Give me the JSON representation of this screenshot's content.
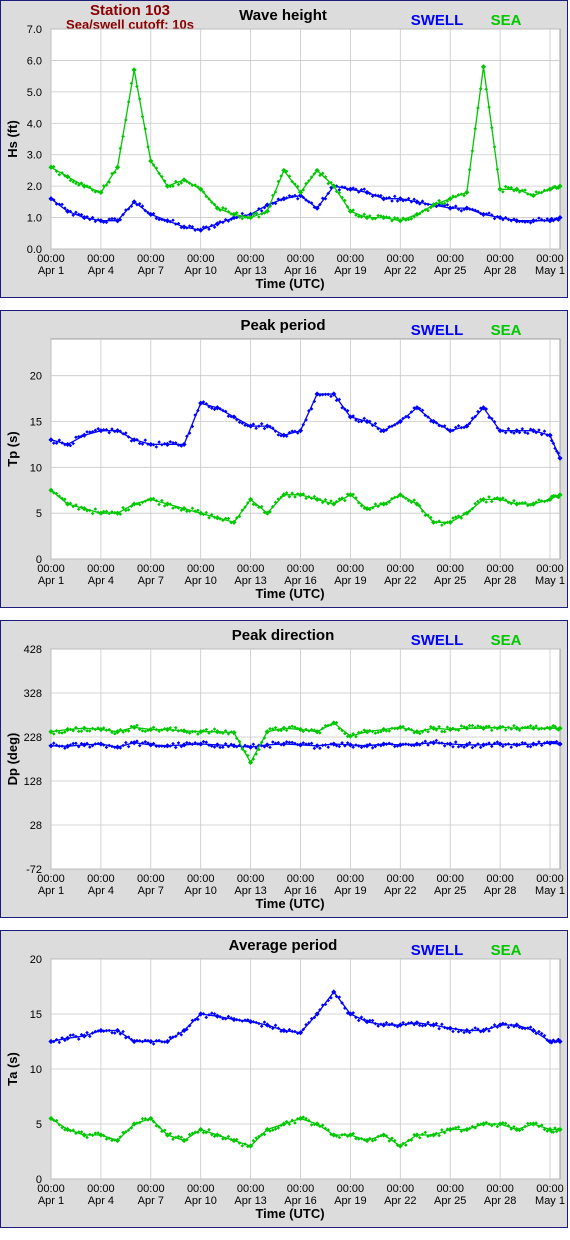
{
  "header": {
    "station": "Station 103",
    "cutoff": "Sea/swell cutoff: 10s"
  },
  "legend": {
    "swell": "SWELL",
    "sea": "SEA"
  },
  "colors": {
    "swell": "#0000ff",
    "sea": "#00c800",
    "title_red": "#8b0000",
    "border": "#1c1c7c"
  },
  "x_ticks": [
    "Apr 1",
    "Apr 4",
    "Apr 7",
    "Apr 10",
    "Apr 13",
    "Apr 16",
    "Apr 19",
    "Apr 22",
    "Apr 25",
    "Apr 28",
    "May 1"
  ],
  "x_tick_time": "00:00",
  "xlabel": "Time (UTC)",
  "chart_data": [
    {
      "type": "scatter",
      "title": "Wave height",
      "ylabel": "Hs (ft)",
      "ylim": [
        0,
        7
      ],
      "yticks": [
        "0.0",
        "1.0",
        "2.0",
        "3.0",
        "4.0",
        "5.0",
        "6.0",
        "7.0"
      ],
      "x": [
        0,
        1,
        2,
        3,
        4,
        5,
        6,
        7,
        8,
        9,
        10,
        11,
        12,
        13,
        14,
        15,
        16,
        17,
        18,
        19,
        20,
        21,
        22,
        23,
        24,
        25,
        26,
        27,
        28,
        29,
        30,
        30.6
      ],
      "series": [
        {
          "name": "SWELL",
          "values": [
            1.6,
            1.2,
            1.0,
            0.9,
            0.9,
            1.5,
            1.1,
            0.9,
            0.7,
            0.6,
            0.8,
            1.0,
            1.1,
            1.4,
            1.6,
            1.7,
            1.3,
            2.0,
            1.9,
            1.8,
            1.6,
            1.6,
            1.5,
            1.4,
            1.3,
            1.3,
            1.1,
            1.0,
            0.9,
            0.9,
            0.9,
            1.0
          ]
        },
        {
          "name": "SEA",
          "values": [
            2.6,
            2.3,
            2.0,
            1.8,
            2.6,
            5.7,
            2.8,
            2.0,
            2.2,
            1.9,
            1.3,
            1.1,
            1.0,
            1.2,
            2.5,
            1.8,
            2.5,
            2.0,
            1.2,
            1.0,
            1.0,
            0.9,
            1.1,
            1.4,
            1.6,
            1.8,
            5.8,
            1.9,
            1.9,
            1.7,
            1.9,
            2.0
          ]
        }
      ]
    },
    {
      "type": "scatter",
      "title": "Peak period",
      "ylabel": "Tp (s)",
      "ylim": [
        0,
        24
      ],
      "yticks": [
        "0",
        "5",
        "10",
        "15",
        "20"
      ],
      "x": [
        0,
        1,
        2,
        3,
        4,
        5,
        6,
        7,
        8,
        9,
        10,
        11,
        12,
        13,
        14,
        15,
        16,
        17,
        18,
        19,
        20,
        21,
        22,
        23,
        24,
        25,
        26,
        27,
        28,
        29,
        30,
        30.6
      ],
      "series": [
        {
          "name": "SWELL",
          "values": [
            13,
            12.5,
            13.5,
            14,
            14,
            13,
            12.5,
            12.5,
            12.5,
            17,
            16.5,
            15.5,
            14.5,
            14.5,
            13.5,
            14,
            18,
            18,
            15.5,
            15,
            14,
            15,
            16.5,
            15,
            14,
            14.5,
            16.5,
            14,
            14,
            14,
            13.5,
            11
          ]
        },
        {
          "name": "SEA",
          "values": [
            7.5,
            6,
            5.5,
            5,
            5,
            6,
            6.5,
            6,
            5.5,
            5,
            4.5,
            4,
            6.5,
            5,
            7,
            7,
            6.5,
            6,
            7,
            5.5,
            6,
            7,
            6,
            4,
            4,
            5,
            6.5,
            6.5,
            6,
            6,
            6.5,
            7
          ]
        }
      ]
    },
    {
      "type": "scatter",
      "title": "Peak direction",
      "ylabel": "Dp (deg)",
      "ylim": [
        -72,
        428
      ],
      "yticks": [
        "-72",
        "28",
        "128",
        "228",
        "328",
        "428"
      ],
      "x": [
        0,
        1,
        2,
        3,
        4,
        5,
        6,
        7,
        8,
        9,
        10,
        11,
        12,
        13,
        14,
        15,
        16,
        17,
        18,
        19,
        20,
        21,
        22,
        23,
        24,
        25,
        26,
        27,
        28,
        29,
        30,
        30.6
      ],
      "series": [
        {
          "name": "SWELL",
          "values": [
            208,
            207,
            210,
            212,
            205,
            215,
            210,
            208,
            210,
            212,
            210,
            208,
            205,
            210,
            212,
            210,
            208,
            212,
            210,
            208,
            212,
            210,
            212,
            215,
            212,
            210,
            210,
            212,
            210,
            212,
            214,
            212
          ]
        },
        {
          "name": "SEA",
          "values": [
            240,
            245,
            248,
            245,
            240,
            250,
            245,
            245,
            242,
            240,
            240,
            238,
            170,
            240,
            248,
            245,
            240,
            260,
            230,
            240,
            245,
            250,
            240,
            248,
            245,
            248,
            248,
            250,
            248,
            248,
            248,
            248
          ]
        }
      ]
    },
    {
      "type": "scatter",
      "title": "Average period",
      "ylabel": "Ta (s)",
      "ylim": [
        0,
        20
      ],
      "yticks": [
        "0",
        "5",
        "10",
        "15",
        "20"
      ],
      "x": [
        0,
        1,
        2,
        3,
        4,
        5,
        6,
        7,
        8,
        9,
        10,
        11,
        12,
        13,
        14,
        15,
        16,
        17,
        18,
        19,
        20,
        21,
        22,
        23,
        24,
        25,
        26,
        27,
        28,
        29,
        30,
        30.6
      ],
      "series": [
        {
          "name": "SWELL",
          "values": [
            12.5,
            12.8,
            13,
            13.5,
            13.5,
            12.5,
            12.5,
            12.5,
            13.5,
            15,
            14.8,
            14.5,
            14.3,
            14,
            13.5,
            13.3,
            15,
            17,
            15,
            14.3,
            14,
            14,
            14.2,
            14,
            13.7,
            13.5,
            13.5,
            14,
            14,
            13.5,
            12.5,
            12.5
          ]
        },
        {
          "name": "SEA",
          "values": [
            5.5,
            4.5,
            4,
            4,
            3.5,
            5,
            5.5,
            4,
            3.5,
            4.5,
            4,
            3.5,
            3,
            4.5,
            5,
            5.5,
            5,
            4,
            4,
            3.5,
            4,
            3,
            4,
            4,
            4.5,
            4.5,
            5,
            5,
            4.5,
            5,
            4.5,
            4.5
          ]
        }
      ]
    }
  ]
}
